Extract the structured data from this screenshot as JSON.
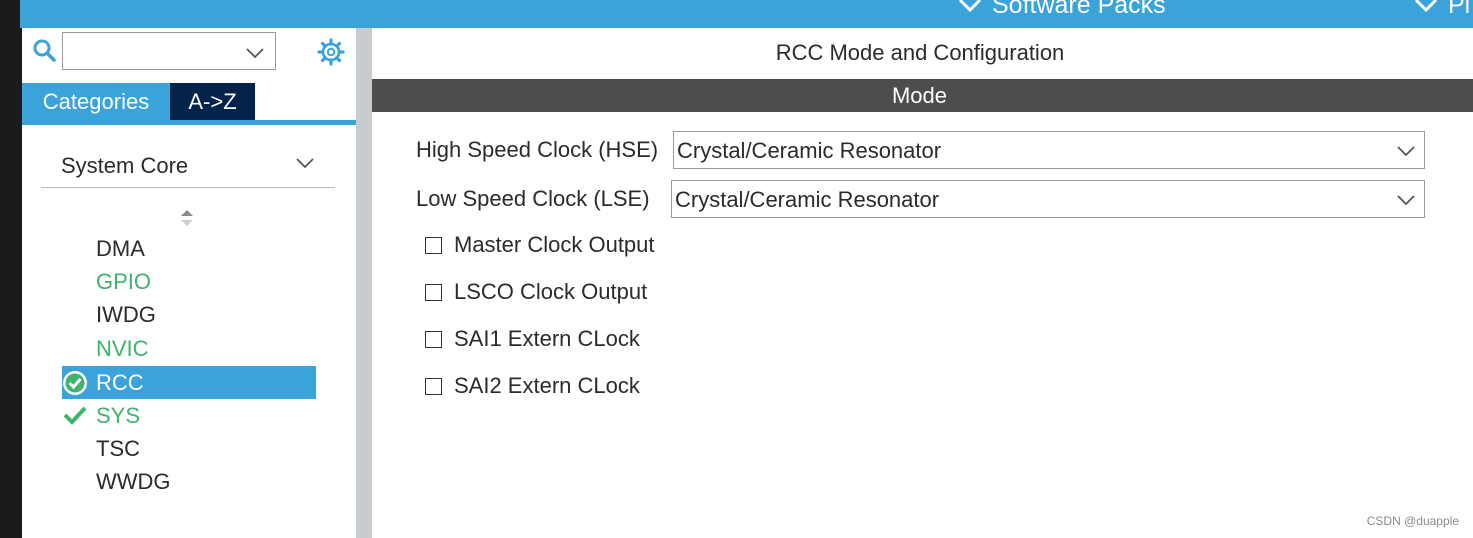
{
  "topbar": {
    "menus": [
      "Software Packs",
      "Pi"
    ]
  },
  "sidebar": {
    "search": {
      "value": "",
      "placeholder": ""
    },
    "tabs": [
      {
        "label": "Categories",
        "active": true
      },
      {
        "label": "A->Z",
        "active": false
      }
    ],
    "category": "System Core",
    "items": [
      {
        "label": "DMA",
        "state": "plain"
      },
      {
        "label": "GPIO",
        "state": "green"
      },
      {
        "label": "IWDG",
        "state": "plain"
      },
      {
        "label": "NVIC",
        "state": "green"
      },
      {
        "label": "RCC",
        "state": "selected",
        "icon": "check-circle-icon"
      },
      {
        "label": "SYS",
        "state": "green",
        "icon": "check-icon"
      },
      {
        "label": "TSC",
        "state": "plain"
      },
      {
        "label": "WWDG",
        "state": "plain"
      }
    ]
  },
  "main": {
    "title": "RCC Mode and Configuration",
    "mode_header": "Mode",
    "hse": {
      "label": "High Speed Clock (HSE)",
      "value": "Crystal/Ceramic Resonator"
    },
    "lse": {
      "label": "Low Speed Clock (LSE)",
      "value": "Crystal/Ceramic Resonator"
    },
    "options": [
      {
        "label": "Master Clock Output",
        "checked": false
      },
      {
        "label": "LSCO Clock Output",
        "checked": false
      },
      {
        "label": "SAI1 Extern CLock",
        "checked": false
      },
      {
        "label": "SAI2 Extern CLock",
        "checked": false
      }
    ]
  },
  "watermark": "CSDN @duapple",
  "colors": {
    "accent": "#3aa3d9",
    "dark_tab": "#03234b",
    "mode_bar": "#4d4d4d",
    "ok_green": "#3db36b"
  }
}
